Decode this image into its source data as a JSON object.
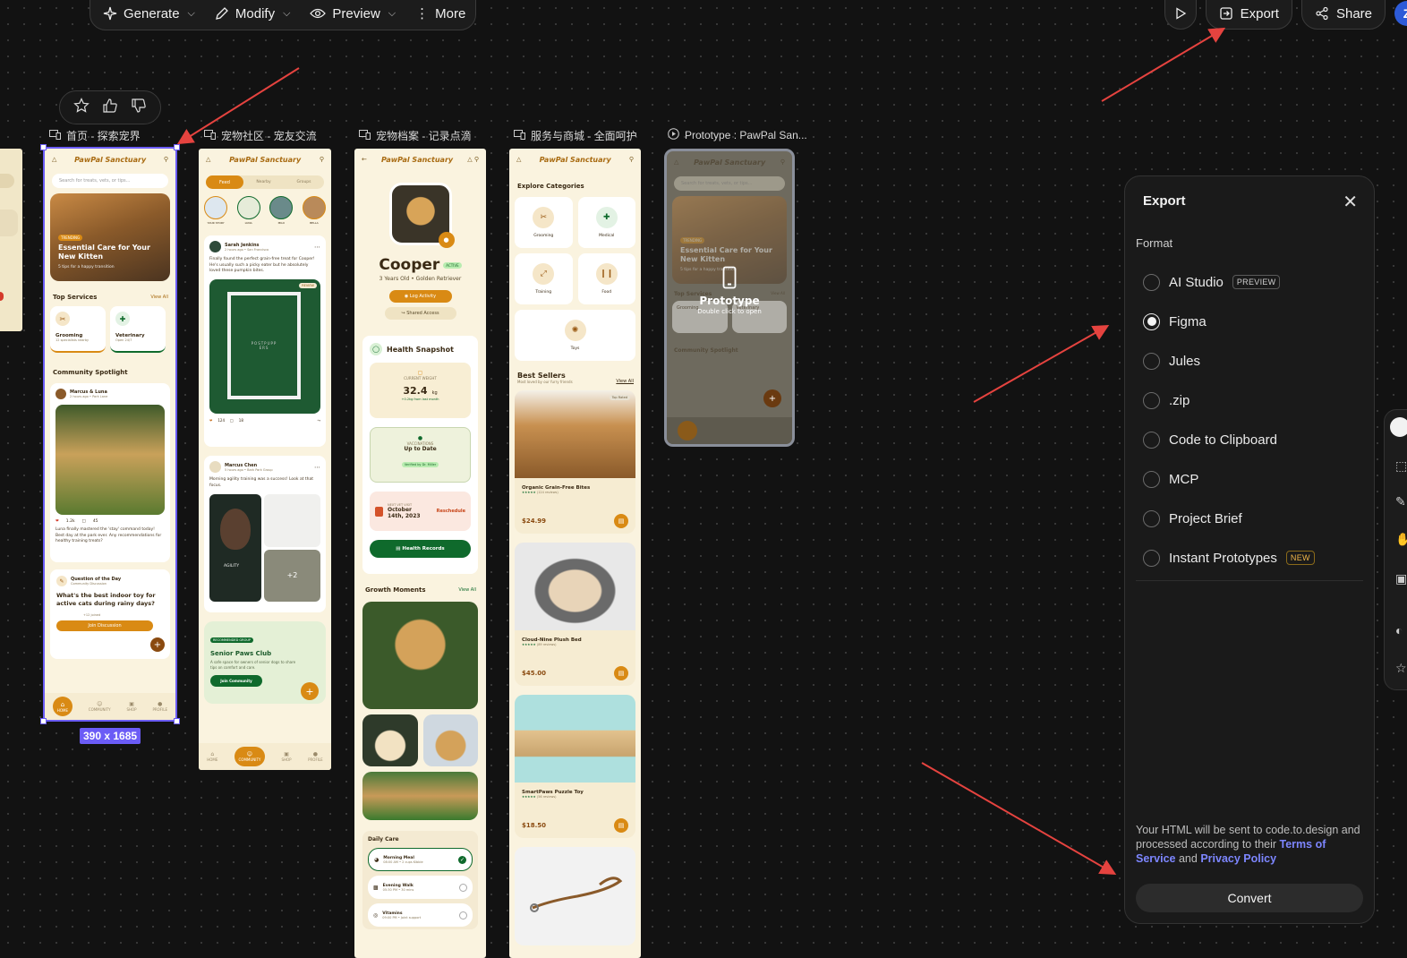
{
  "toolbar": {
    "generate": "Generate",
    "modify": "Modify",
    "preview": "Preview",
    "more": "More"
  },
  "right_tools": {
    "export": "Export",
    "share": "Share",
    "avatar": "Z"
  },
  "frames": {
    "home": {
      "label": "首页 - 探索宠界"
    },
    "community": {
      "label": "宠物社区 - 宠友交流"
    },
    "profile": {
      "label": "宠物档案 - 记录点滴"
    },
    "shop": {
      "label": "服务与商城 - 全面呵护"
    },
    "prototype": {
      "label": "Prototype : PawPal San..."
    }
  },
  "selection_size": "390 x 1685",
  "home_app": {
    "title": "PawPal Sanctuary",
    "search_placeholder": "Search for treats, vets, or tips...",
    "trending_tag": "TRENDING",
    "hero_title": "Essential Care for Your New Kitten",
    "hero_sub": "5 tips for a happy transition",
    "top_services": "Top Services",
    "view_all": "View All",
    "svc1": "Grooming",
    "svc1_sub": "12 specialists nearby",
    "svc2": "Veterinary",
    "svc2_sub": "Open 24/7",
    "community": "Community Spotlight",
    "post_author": "Marcus & Luna",
    "post_meta": "2 hours ago • Park Lane",
    "likes": "1.2k",
    "comments": "45",
    "post_text": "Luna finally mastered the 'stay' command today! Best day at the park ever. Any recommendations for healthy training treats?",
    "qotd": "Question of the Day",
    "qotd_sub": "Community Discussion",
    "qotd_q": "What's the best indoor toy for active cats during rainy days?",
    "joined": "+12 joined",
    "join_btn": "Join Discussion",
    "nav": [
      "HOME",
      "COMMUNITY",
      "SHOP",
      "PROFILE"
    ]
  },
  "community_app": {
    "title": "PawPal Sanctuary",
    "tabs": [
      "Feed",
      "Nearby",
      "Groups"
    ],
    "stories": [
      "YOUR STORY",
      "LUNA",
      "MILO",
      "BELLA"
    ],
    "post1_author": "Sarah Jenkins",
    "post1_meta": "2 hours ago • San Francisco",
    "post1_text": "Finally found the perfect grain-free treat for Cooper! He's usually such a picky eater but he absolutely loved these pumpkin bites.",
    "poster_text": "POSTPUPPERS",
    "reviews_tag": "REVIEW",
    "post1_likes": "124",
    "post1_comments": "18",
    "post2_author": "Marcus Chen",
    "post2_meta": "5 hours ago • Bark Park Group",
    "post2_text": "Morning agility training was a success! Look at that focus.",
    "agility": "AGILITY",
    "more_count": "+2",
    "group_tag": "RECOMMENDED GROUP",
    "group_title": "Senior Paws Club",
    "group_text": "A safe space for owners of senior dogs to share tips on comfort and care.",
    "join_btn": "Join Community",
    "nav": [
      "HOME",
      "COMMUNITY",
      "SHOP",
      "PROFILE"
    ]
  },
  "profile_app": {
    "title": "PawPal Sanctuary",
    "pet_name": "Cooper",
    "status": "ACTIVE",
    "pet_meta": "3 Years Old • Golden Retriever",
    "log_btn": "Log Activity",
    "shared_btn": "Shared Access",
    "health": "Health Snapshot",
    "weight_label": "CURRENT WEIGHT",
    "weight": "32.4",
    "weight_unit": "kg",
    "weight_delta": "+0.2kg from last month",
    "vacc_label": "VACCINATIONS",
    "vacc_value": "Up to Date",
    "vacc_by": "Verified by Dr. Miller",
    "visit_label": "NEXT VET VISIT",
    "visit_date": "October 14th, 2023",
    "reschedule": "Reschedule",
    "records_btn": "Health Records",
    "growth": "Growth Moments",
    "view_all": "View All",
    "daily": "Daily Care",
    "care": [
      {
        "title": "Morning Meal",
        "sub": "08:00 AM • 2 cups Kibble"
      },
      {
        "title": "Evening Walk",
        "sub": "05:30 PM • 30 mins"
      },
      {
        "title": "Vitamins",
        "sub": "09:00 PM • Joint support"
      }
    ]
  },
  "shop_app": {
    "title": "PawPal Sanctuary",
    "explore": "Explore Categories",
    "cats": [
      "Grooming",
      "Medical",
      "Training",
      "Food",
      "Toys"
    ],
    "best": "Best Sellers",
    "best_sub": "Most loved by our furry friends",
    "view_all": "View All",
    "top_rated": "Top Rated",
    "products": [
      {
        "name": "Organic Grain-Free Bites",
        "reviews": "(124 reviews)",
        "price": "$24.99"
      },
      {
        "name": "Cloud-Nine Plush Bed",
        "reviews": "(89 reviews)",
        "price": "$45.00"
      },
      {
        "name": "SmartPaws Puzzle Toy",
        "reviews": "(56 reviews)",
        "price": "$18.50"
      }
    ]
  },
  "prototype_overlay": {
    "title": "Prototype",
    "hint": "Double click to open",
    "app_title": "PawPal Sanctuary",
    "search": "Search for treats, vets, or tips...",
    "trending": "TRENDING",
    "hero": "Essential Care for Your New Kitten",
    "hero_sub": "5 tips for a happy transition",
    "top_services": "Top Services",
    "view_all": "View All",
    "svc1": "Grooming",
    "svc2": "Veterinary",
    "community": "Community Spotlight"
  },
  "export_panel": {
    "title": "Export",
    "format_label": "Format",
    "options": [
      {
        "label": "AI Studio",
        "tag": "PREVIEW",
        "selected": false
      },
      {
        "label": "Figma",
        "tag": "",
        "selected": true
      },
      {
        "label": "Jules",
        "tag": "",
        "selected": false
      },
      {
        "label": ".zip",
        "tag": "",
        "selected": false
      },
      {
        "label": "Code to Clipboard",
        "tag": "",
        "selected": false
      },
      {
        "label": "MCP",
        "tag": "",
        "selected": false
      },
      {
        "label": "Project Brief",
        "tag": "",
        "selected": false
      },
      {
        "label": "Instant Prototypes",
        "tag": "NEW",
        "selected": false
      }
    ],
    "legal_prefix": "Your HTML will be sent to code.to.design and processed according to their",
    "terms": "Terms of Service",
    "and": "and",
    "privacy": "Privacy Policy",
    "convert": "Convert"
  },
  "colors": {
    "accent_purple": "#6b5cf6",
    "arrow_red": "#e5433f",
    "app_cream": "#faf3df",
    "app_orange": "#d98a14",
    "app_green": "#0f6a2c",
    "link_blue": "#7d86ff"
  }
}
